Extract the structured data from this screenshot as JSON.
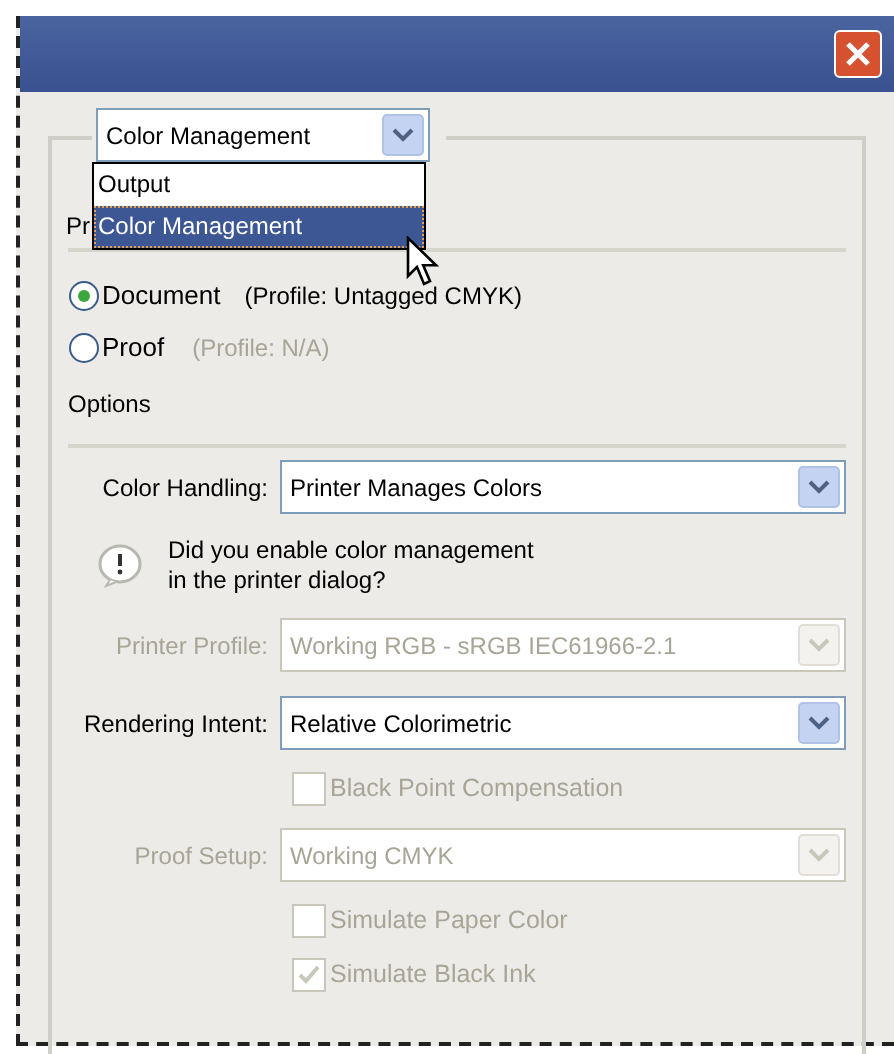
{
  "panel_menu": {
    "value": "Color Management",
    "open": true,
    "options": [
      {
        "label": "Output",
        "selected": false
      },
      {
        "label": "Color Management",
        "selected": true
      }
    ]
  },
  "section_label": "Pr",
  "source": [
    {
      "label": "Document",
      "selected": true,
      "profile": "(Profile: Untagged CMYK)",
      "profile_disabled": false
    },
    {
      "label": "Proof",
      "selected": false,
      "profile": "(Profile: N/A)",
      "profile_disabled": true
    }
  ],
  "options_label": "Options",
  "rows": [
    {
      "kind": "select",
      "label": "Color Handling:",
      "value": "Printer Manages Colors",
      "disabled": false
    },
    {
      "kind": "warning",
      "text": "Did you enable color management\nin the printer dialog?"
    },
    {
      "kind": "select",
      "label": "Printer Profile:",
      "value": "Working RGB - sRGB IEC61966-2.1",
      "disabled": true
    },
    {
      "kind": "select",
      "label": "Rendering Intent:",
      "value": "Relative Colorimetric",
      "disabled": false
    },
    {
      "kind": "checkbox",
      "label": "Black Point Compensation",
      "checked": false,
      "disabled": true
    },
    {
      "kind": "select",
      "label": "Proof Setup:",
      "value": "Working CMYK",
      "disabled": true
    },
    {
      "kind": "checkbox",
      "label": "Simulate Paper Color",
      "checked": false,
      "disabled": true
    },
    {
      "kind": "checkbox",
      "label": "Simulate Black Ink",
      "checked": true,
      "disabled": true
    }
  ]
}
